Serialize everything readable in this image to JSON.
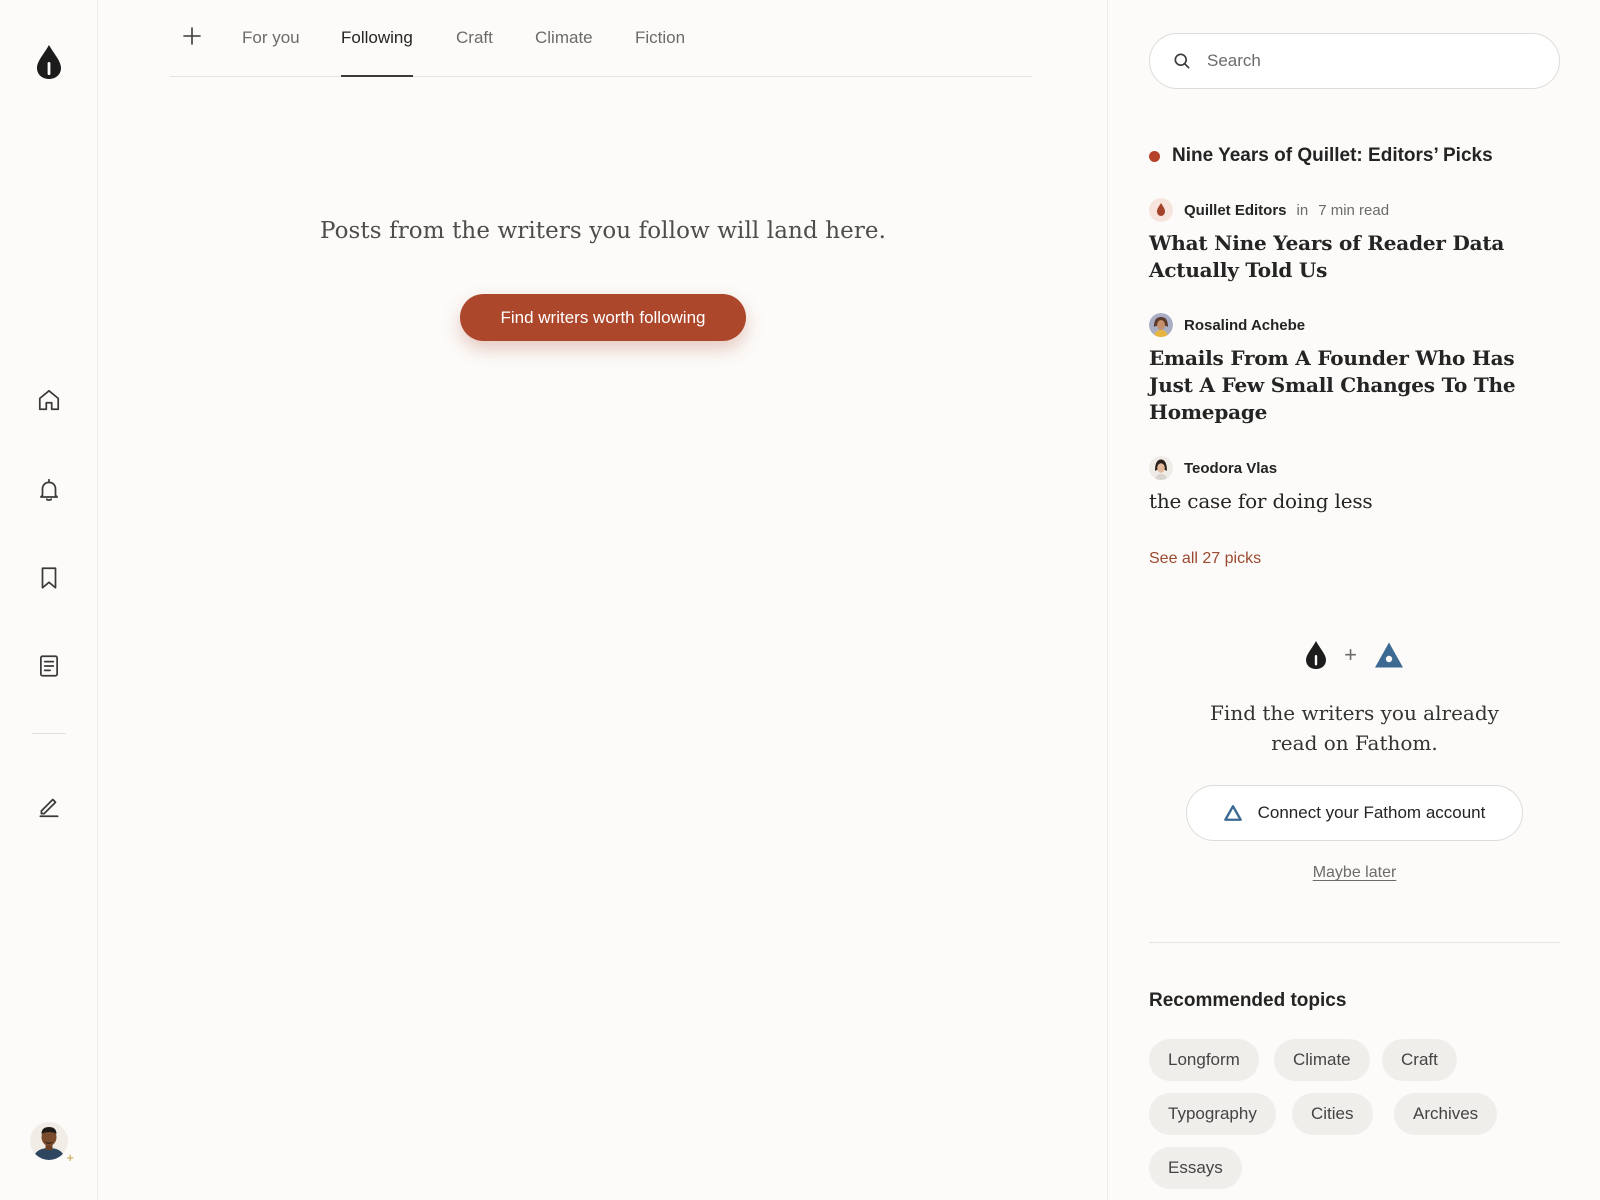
{
  "rail": {
    "nav": [
      {
        "name": "home",
        "icon": "home-icon"
      },
      {
        "name": "notifications",
        "icon": "bell-icon"
      },
      {
        "name": "library",
        "icon": "bookmark-icon"
      },
      {
        "name": "stories",
        "icon": "document-icon"
      },
      {
        "name": "write",
        "icon": "pencil-icon"
      }
    ],
    "logo_icon": "quill-drop-logo",
    "avatar_icon": "user-avatar"
  },
  "tabs": {
    "add_icon": "plus-icon",
    "items": [
      {
        "label": "For you",
        "active": false
      },
      {
        "label": "Following",
        "active": true
      },
      {
        "label": "Craft",
        "active": false
      },
      {
        "label": "Climate",
        "active": false
      },
      {
        "label": "Fiction",
        "active": false
      }
    ]
  },
  "main": {
    "empty_message": "Posts from the writers you follow will land here.",
    "cta_label": "Find writers worth following"
  },
  "sidebar": {
    "search": {
      "placeholder": "Search"
    },
    "picks": {
      "heading": "Nine Years of Quillet: Editors’ Picks",
      "items": [
        {
          "author": "Quillet Editors",
          "in": "in",
          "read_time": "7 min read",
          "title": "What Nine Years of Reader Data Actually Told Us"
        },
        {
          "author": "Rosalind Achebe",
          "title": "Emails From A Founder Who Has Just A Few Small Changes To The Homepage"
        },
        {
          "author": "Teodora Vlas",
          "title": "the case for doing less"
        }
      ],
      "see_all": "See all 27 picks"
    },
    "connect": {
      "plus": "+",
      "text_line1": "Find the writers you already",
      "text_line2": "read on Fathom.",
      "button_label": "Connect your Fathom account",
      "maybe_later": "Maybe later"
    },
    "topics": {
      "heading": "Recommended topics",
      "chips": [
        "Longform",
        "Climate",
        "Craft",
        "Typography",
        "Cities",
        "Archives",
        "Essays"
      ]
    }
  },
  "colors": {
    "accent": "#ad472b",
    "background": "#fcfbf9",
    "fathom_blue": "#3d6a92",
    "picks_dot": "#b5432b",
    "link": "#9b4a2f"
  }
}
